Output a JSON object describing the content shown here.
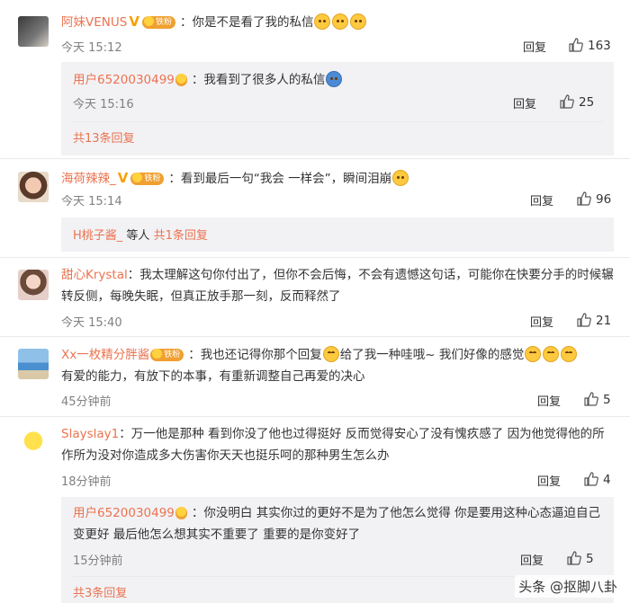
{
  "comments": [
    {
      "username": "阿妹VENUS",
      "fan_badge": "铁粉",
      "text": "你是不是看了我的私信",
      "time": "今天 15:12",
      "reply_label": "回复",
      "likes": "163",
      "sub": {
        "username": "用户6520030499",
        "text": "我看到了很多人的私信",
        "time": "今天 15:16",
        "reply_label": "回复",
        "likes": "25",
        "more": "共13条回复"
      }
    },
    {
      "username": "海荷辣辣_",
      "fan_badge": "铁粉",
      "text": "看到最后一句“我会 一样会”，瞬间泪崩",
      "time": "今天 15:14",
      "reply_label": "回复",
      "likes": "96",
      "sub_more_user": "H桃子酱_",
      "sub_more_text": "等人",
      "sub_more_count": "共1条回复"
    },
    {
      "username": "甜心Krystal",
      "text": "我太理解这句你付出了，但你不会后悔，不会有遗憾这句话，可能你在快要分手的时候辗转反侧，每晚失眠，但真正放手那一刻，反而释然了",
      "time": "今天 15:40",
      "reply_label": "回复",
      "likes": "21"
    },
    {
      "username": "Xx一枚精分胖酱",
      "fan_badge": "铁粉",
      "text_a": "我也还记得你那个回复",
      "text_b": "给了我一种哇哦~ 我们好像的感觉",
      "text_c": "有爱的能力，有放下的本事，有重新调整自己再爱的决心",
      "time": "45分钟前",
      "reply_label": "回复",
      "likes": "5"
    },
    {
      "username": "Slayslay1",
      "text": "万一他是那种 看到你没了他也过得挺好 反而觉得安心了没有愧疚感了 因为他觉得他的所作所为没对你造成多大伤害你天天也挺乐呵的那种男生怎么办",
      "time": "18分钟前",
      "reply_label": "回复",
      "likes": "4",
      "sub": {
        "username": "用户6520030499",
        "text": "你没明白 其实你过的更好不是为了他怎么觉得 你是要用这种心态逼迫自己变更好 最后他怎么想其实不重要了 重要的是你变好了",
        "time": "15分钟前",
        "reply_label": "回复",
        "likes": "5",
        "more": "共3条回复"
      }
    }
  ],
  "watermark": "头条 @抠脚八卦",
  "colors": {
    "username": "#eb7350",
    "sub_bg": "#f2f2f5",
    "meta": "#808080"
  }
}
